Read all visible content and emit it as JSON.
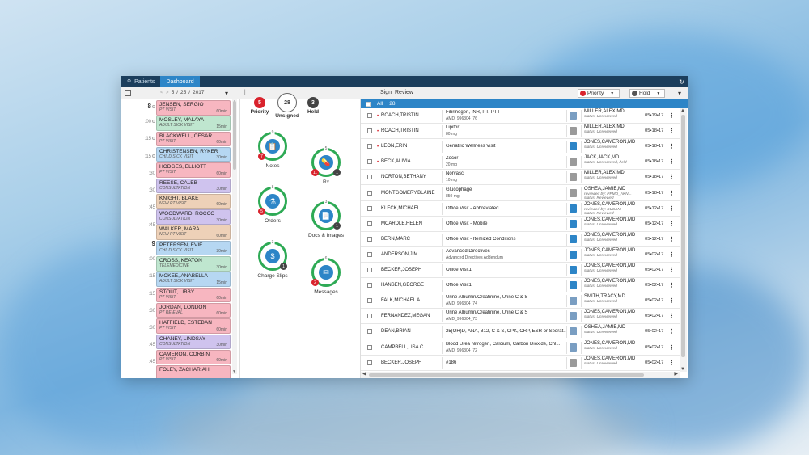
{
  "topbar": {
    "tabs": [
      {
        "label": "Patients"
      },
      {
        "label": "Dashboard"
      }
    ]
  },
  "toolbar": {
    "date": {
      "month": "5",
      "day": "25",
      "year": "2017"
    },
    "sign_label": "Sign",
    "review_label": "Review",
    "priority_label": "Priority",
    "hold_label": "Hold"
  },
  "schedule": {
    "times": [
      {
        "label": "8",
        "hour": true,
        "circle": true
      },
      {
        "label": ":00",
        "hour": false,
        "circle": true
      },
      {
        "label": ":15",
        "hour": false,
        "circle": true
      },
      {
        "label": ":15",
        "hour": false,
        "circle": true
      },
      {
        "label": ":30",
        "hour": false,
        "circle": false
      },
      {
        "label": ":30",
        "hour": false,
        "circle": false
      },
      {
        "label": ":45",
        "hour": false,
        "circle": false
      },
      {
        "label": ":45",
        "hour": false,
        "circle": false
      },
      {
        "label": "9",
        "hour": true,
        "circle": false
      },
      {
        "label": ":00",
        "hour": false,
        "circle": false
      },
      {
        "label": ":15",
        "hour": false,
        "circle": false
      },
      {
        "label": ":15",
        "hour": false,
        "circle": false
      },
      {
        "label": ":30",
        "hour": false,
        "circle": false
      },
      {
        "label": ":30",
        "hour": false,
        "circle": false
      },
      {
        "label": ":45",
        "hour": false,
        "circle": false
      },
      {
        "label": ":45",
        "hour": false,
        "circle": false
      },
      {
        "label": "10",
        "hour": true,
        "circle": false
      }
    ],
    "appointments": [
      {
        "name": "JENSEN, SERGIO",
        "type": "PT VISIT",
        "duration": "60min",
        "color": "#f7b6c0"
      },
      {
        "name": "MOSLEY, MALAYA",
        "type": "ADULT SICK VISIT",
        "duration": "15min",
        "color": "#bfe6cf"
      },
      {
        "name": "BLACKWELL, CESAR",
        "type": "PT VISIT",
        "duration": "60min",
        "color": "#f7b6c0"
      },
      {
        "name": "CHRISTENSEN, RYKER",
        "type": "CHILD SICK VISIT",
        "duration": "30min",
        "color": "#b6d7f2"
      },
      {
        "name": "HODGES, ELLIOTT",
        "type": "PT VISIT",
        "duration": "60min",
        "color": "#f7b6c0"
      },
      {
        "name": "REESE, CALEB",
        "type": "CONSULTATION",
        "duration": "30min",
        "color": "#cfc3ee"
      },
      {
        "name": "KNIGHT, BLAKE",
        "type": "NEW PT VISIT",
        "duration": "60min",
        "color": "#eed1b8"
      },
      {
        "name": "WOODWARD, ROCCO",
        "type": "CONSULTATION",
        "duration": "30min",
        "color": "#cfc3ee"
      },
      {
        "name": "WALKER, MARA",
        "type": "NEW PT VISIT",
        "duration": "60min",
        "color": "#eed1b8"
      },
      {
        "name": "PETERSEN, EVIE",
        "type": "CHILD SICK VISIT",
        "duration": "30min",
        "color": "#b6d7f2"
      },
      {
        "name": "CROSS, KEATON",
        "type": "TELEMEDICINE",
        "duration": "30min",
        "color": "#bfe6cf"
      },
      {
        "name": "MCKEE, ANABELLA",
        "type": "ADULT SICK VISIT",
        "duration": "15min",
        "color": "#b6d7f2"
      },
      {
        "name": "STOUT, LIBBY",
        "type": "PT VISIT",
        "duration": "60min",
        "color": "#f7b6c0"
      },
      {
        "name": "JORDAN, LONDON",
        "type": "PT RE-EVAL",
        "duration": "60min",
        "color": "#f7b6c0"
      },
      {
        "name": "HATFIELD, ESTEBAN",
        "type": "PT VISIT",
        "duration": "60min",
        "color": "#f7b6c0"
      },
      {
        "name": "CHANEY, LINDSAY",
        "type": "CONSULTATION",
        "duration": "30min",
        "color": "#cfc3ee"
      },
      {
        "name": "CAMERON, CORBIN",
        "type": "PT VISIT",
        "duration": "60min",
        "color": "#f7b6c0"
      },
      {
        "name": "FOLEY, ZACHARIAH",
        "type": "",
        "duration": "",
        "color": "#f7b6c0"
      }
    ]
  },
  "dashboard": {
    "counters": [
      {
        "value": "5",
        "label": "Priority",
        "color": "#d9232d"
      },
      {
        "value": "28",
        "label": "Unsigned",
        "color": "#ffffff"
      },
      {
        "value": "3",
        "label": "Held",
        "color": "#444444"
      }
    ],
    "widgets": [
      {
        "label": "Notes",
        "icon": "clipboard-icon",
        "top": "9",
        "badge": "7",
        "badge2": "",
        "fill": "#2d85c7",
        "glyph": "📋"
      },
      {
        "label": "Rx",
        "icon": "pill-icon",
        "top": "5",
        "badge": "11",
        "badge2": "1",
        "fill": "#2d85c7",
        "glyph": "💊"
      },
      {
        "label": "Orders",
        "icon": "flask-icon",
        "top": "8",
        "badge": "5",
        "badge2": "",
        "fill": "#2d85c7",
        "glyph": "⚗"
      },
      {
        "label": "Docs & Images",
        "icon": "document-icon",
        "top": "3",
        "badge": "",
        "badge2": "1",
        "fill": "#2d85c7",
        "glyph": "📄"
      },
      {
        "label": "Charge Slips",
        "icon": "dollar-icon",
        "top": "3",
        "badge": "",
        "badge2": "1",
        "fill": "#2d85c7",
        "glyph": "$"
      },
      {
        "label": "Messages",
        "icon": "envelope-icon",
        "top": "6",
        "badge": "2",
        "badge2": "",
        "fill": "#2d85c7",
        "glyph": "✉"
      }
    ]
  },
  "list": {
    "header": {
      "all_label": "All",
      "count": "28"
    },
    "rows": [
      {
        "priority": true,
        "patient": "ROACH,TRISTIN",
        "desc1": "Fibrinogen, INR, PT, PTT",
        "desc2": "AMD_996304_76",
        "icon_color": "#7a9ec2",
        "provider": "MILLER,ALEX,MD",
        "status": "status: Unreviewed",
        "status2": "",
        "date": "05•19•17"
      },
      {
        "priority": true,
        "patient": "ROACH,TRISTIN",
        "desc1": "Lipitor",
        "desc2": "80 mg",
        "icon_color": "#9a9a9a",
        "provider": "MILLER,ALEX,MD",
        "status": "status: Unreviewed",
        "status2": "",
        "date": "05•18•17"
      },
      {
        "priority": true,
        "patient": "LEON,ERIN",
        "desc1": "Geriatric Wellness Visit",
        "desc2": "",
        "icon_color": "#2d85c7",
        "provider": "JONES,CAMERON,MD",
        "status": "status: Unreviewed",
        "status2": "",
        "date": "05•18•17"
      },
      {
        "priority": true,
        "patient": "BECK,ALIVIA",
        "desc1": "Zocor",
        "desc2": "20 mg",
        "icon_color": "#9a9a9a",
        "provider": "JACK,JACK,MD",
        "status": "status: Unreviewed, held",
        "status2": "",
        "date": "05•18•17"
      },
      {
        "priority": false,
        "patient": "NORTON,BETHANY",
        "desc1": "Norvasc",
        "desc2": "10 mg",
        "icon_color": "#9a9a9a",
        "provider": "MILLER,ALEX,MD",
        "status": "status: Unreviewed",
        "status2": "",
        "date": "05•18•17"
      },
      {
        "priority": false,
        "patient": "MONTGOMERY,BLAINE",
        "desc1": "Glucophage",
        "desc2": "850 mg",
        "icon_color": "#9a9a9a",
        "provider": "OSHEA,JAMIE,MD",
        "status": "reviewed by: PPMD_AKN...",
        "status2": "status: Reviewed",
        "date": "05•18•17"
      },
      {
        "priority": false,
        "patient": "KLECK,MICHAEL",
        "desc1": "Office Visit - Abbreviated",
        "desc2": "",
        "icon_color": "#2d85c7",
        "provider": "JONES,CAMERON,MD",
        "status": "reviewed by: SUSAN",
        "status2": "status: Reviewed",
        "date": "05•12•17"
      },
      {
        "priority": false,
        "patient": "MCARDLE,HELEN",
        "desc1": "Office Visit - Mobile",
        "desc2": "",
        "icon_color": "#2d85c7",
        "provider": "JONES,CAMERON,MD",
        "status": "status: Unreviewed",
        "status2": "",
        "date": "05•12•17"
      },
      {
        "priority": false,
        "patient": "BERN,MARC",
        "desc1": "Office Visit - Itemized Conditions",
        "desc2": "",
        "icon_color": "#2d85c7",
        "provider": "JONES,CAMERON,MD",
        "status": "status: Unreviewed",
        "status2": "",
        "date": "05•12•17"
      },
      {
        "priority": false,
        "patient": "ANDERSON,JIM",
        "desc1": "Advanced Directives",
        "desc2": "Advanced Directives Addendum",
        "icon_color": "#2d85c7",
        "provider": "JONES,CAMERON,MD",
        "status": "status: Unreviewed",
        "status2": "",
        "date": "05•02•17"
      },
      {
        "priority": false,
        "patient": "BECKER,JOSEPH",
        "desc1": "Office Visit1",
        "desc2": "",
        "icon_color": "#2d85c7",
        "provider": "JONES,CAMERON,MD",
        "status": "status: Unreviewed",
        "status2": "",
        "date": "05•02•17"
      },
      {
        "priority": false,
        "patient": "HANSEN,GEORGE",
        "desc1": "Office Visit1",
        "desc2": "",
        "icon_color": "#2d85c7",
        "provider": "JONES,CAMERON,MD",
        "status": "status: Unreviewed",
        "status2": "",
        "date": "05•02•17"
      },
      {
        "priority": false,
        "patient": "FALK,MICHAEL A",
        "desc1": "Urine Albumin/Creatinine, Urine C & S",
        "desc2": "AMD_996304_74",
        "icon_color": "#7a9ec2",
        "provider": "SMITH,TRACY,MD",
        "status": "status: Unreviewed",
        "status2": "",
        "date": "05•02•17"
      },
      {
        "priority": false,
        "patient": "FERNANDEZ,MEGAN",
        "desc1": "Urine Albumin/Creatinine, Urine C & S",
        "desc2": "AMD_996304_73",
        "icon_color": "#7a9ec2",
        "provider": "JONES,CAMERON,MD",
        "status": "status: Unreviewed",
        "status2": "",
        "date": "05•02•17"
      },
      {
        "priority": false,
        "patient": "DEAN,BRIAN",
        "desc1": "25(OH)D, ANA, B12, C & S, CPK, CRP, ESR or Sedrat...",
        "desc2": "",
        "icon_color": "#7a9ec2",
        "provider": "OSHEA,JAMIE,MD",
        "status": "status: Unreviewed",
        "status2": "",
        "date": "05•02•17"
      },
      {
        "priority": false,
        "patient": "CAMPBELL,LISA C",
        "desc1": "Blood Urea Nitrogen, Calcium, Carbon Dioxide, Chl...",
        "desc2": "AMD_996304_72",
        "icon_color": "#7a9ec2",
        "provider": "JONES,CAMERON,MD",
        "status": "status: Unreviewed",
        "status2": "",
        "date": "05•02•17"
      },
      {
        "priority": false,
        "patient": "BECKER,JOSEPH",
        "desc1": "#186",
        "desc2": "",
        "icon_color": "#9a9a9a",
        "provider": "JONES,CAMERON,MD",
        "status": "status: Unreviewed",
        "status2": "",
        "date": "05•02•17"
      }
    ]
  }
}
